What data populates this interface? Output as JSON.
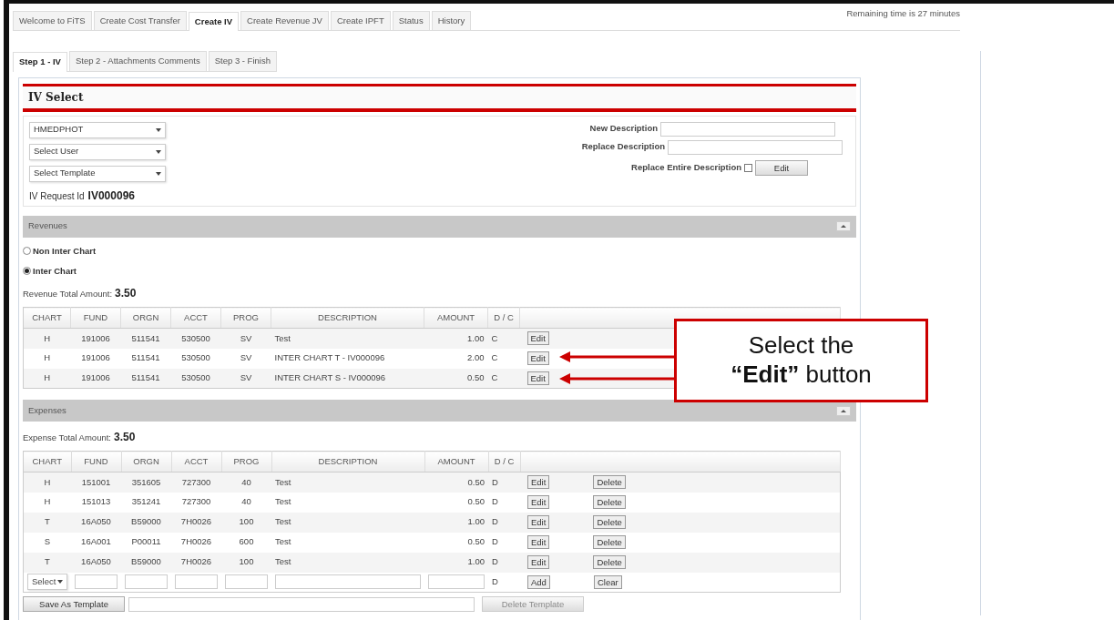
{
  "top_tabs": [
    {
      "label": "Welcome to FiTS",
      "selected": false
    },
    {
      "label": "Create Cost Transfer",
      "selected": false
    },
    {
      "label": "Create IV",
      "selected": true
    },
    {
      "label": "Create Revenue JV",
      "selected": false
    },
    {
      "label": "Create IPFT",
      "selected": false
    },
    {
      "label": "Status",
      "selected": false
    },
    {
      "label": "History",
      "selected": false
    }
  ],
  "remaining_time": "Remaining time is 27 minutes",
  "step_tabs": [
    {
      "label": "Step 1 - IV",
      "selected": true
    },
    {
      "label": "Step 2 - Attachments Comments",
      "selected": false
    },
    {
      "label": "Step 3 - Finish",
      "selected": false
    }
  ],
  "panel_title": "IV Select",
  "selects": [
    {
      "value": "HMEDPHOT"
    },
    {
      "value": "Select User"
    },
    {
      "value": "Select Template"
    }
  ],
  "request_id": {
    "label": "IV Request Id",
    "value": "IV000096"
  },
  "description_fields": [
    {
      "label": "New Description"
    },
    {
      "label": "Replace Description"
    }
  ],
  "replace_entire": {
    "label": "Replace Entire Description",
    "checked": false,
    "button": "Edit"
  },
  "revenues": {
    "title": "Revenues",
    "options": [
      {
        "label": "Non Inter Chart",
        "selected": false
      },
      {
        "label": "Inter Chart",
        "selected": true
      }
    ],
    "total_label": "Revenue Total Amount:",
    "total": "3.50",
    "columns": [
      "CHART",
      "FUND",
      "ORGN",
      "ACCT",
      "PROG",
      "DESCRIPTION",
      "AMOUNT",
      "D / C"
    ],
    "rows": [
      {
        "cells": [
          "H",
          "191006",
          "511541",
          "530500",
          "SV",
          "Test",
          "1.00",
          "C"
        ],
        "actions": [
          "Edit"
        ]
      },
      {
        "cells": [
          "H",
          "191006",
          "511541",
          "530500",
          "SV",
          "INTER CHART T - IV000096",
          "2.00",
          "C"
        ],
        "actions": [
          "Edit"
        ]
      },
      {
        "cells": [
          "H",
          "191006",
          "511541",
          "530500",
          "SV",
          "INTER CHART S - IV000096",
          "0.50",
          "C"
        ],
        "actions": [
          "Edit"
        ]
      }
    ]
  },
  "expenses": {
    "title": "Expenses",
    "total_label": "Expense Total Amount:",
    "total": "3.50",
    "columns": [
      "CHART",
      "FUND",
      "ORGN",
      "ACCT",
      "PROG",
      "DESCRIPTION",
      "AMOUNT",
      "D / C"
    ],
    "rows": [
      {
        "cells": [
          "H",
          "151001",
          "351605",
          "727300",
          "40",
          "Test",
          "0.50",
          "D"
        ],
        "actions": [
          "Edit",
          "Delete"
        ]
      },
      {
        "cells": [
          "H",
          "151013",
          "351241",
          "727300",
          "40",
          "Test",
          "0.50",
          "D"
        ],
        "actions": [
          "Edit",
          "Delete"
        ]
      },
      {
        "cells": [
          "T",
          "16A050",
          "B59000",
          "7H0026",
          "100",
          "Test",
          "1.00",
          "D"
        ],
        "actions": [
          "Edit",
          "Delete"
        ]
      },
      {
        "cells": [
          "S",
          "16A001",
          "P00011",
          "7H0026",
          "600",
          "Test",
          "0.50",
          "D"
        ],
        "actions": [
          "Edit",
          "Delete"
        ]
      },
      {
        "cells": [
          "T",
          "16A050",
          "B59000",
          "7H0026",
          "100",
          "Test",
          "1.00",
          "D"
        ],
        "actions": [
          "Edit",
          "Delete"
        ]
      }
    ],
    "new_row": {
      "chart": "Select",
      "dc": "D",
      "actions": [
        "Add",
        "Clear"
      ]
    }
  },
  "footer": {
    "save": "Save As Template",
    "delete": "Delete Template",
    "delete_disabled": true
  },
  "callout": {
    "text": "Select the **“Edit”** button"
  }
}
